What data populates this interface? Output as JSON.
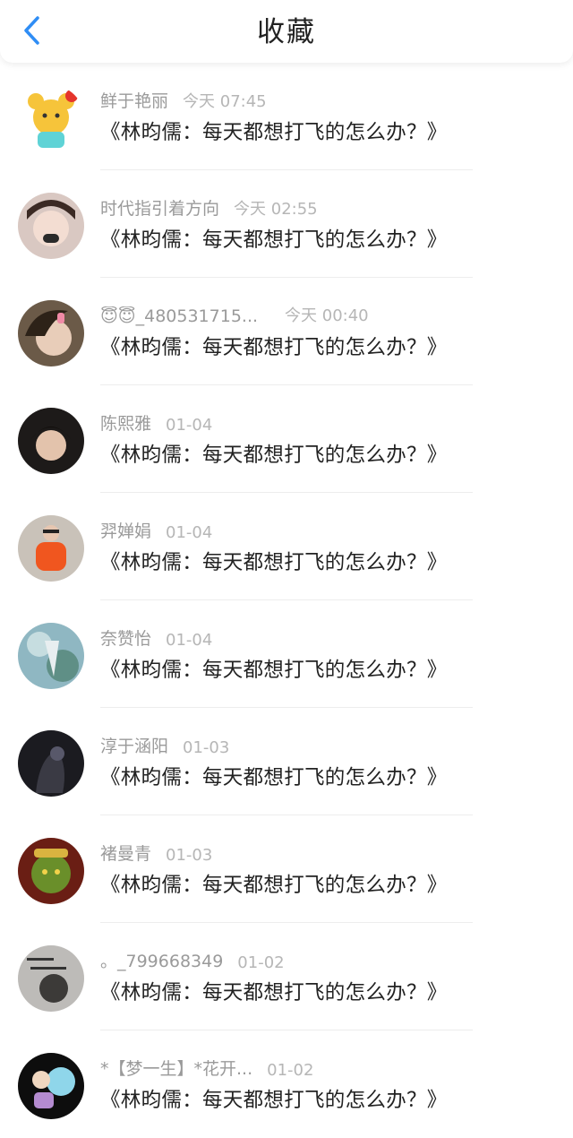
{
  "header": {
    "title": "收藏"
  },
  "items": [
    {
      "name": "鲜于艳丽",
      "time": "今天 07:45",
      "title": "《林昀儒：每天都想打飞的怎么办？》"
    },
    {
      "name": "时代指引着方向",
      "time": "今天 02:55",
      "title": "《林昀儒：每天都想打飞的怎么办？》"
    },
    {
      "name": "😇😇_480531715...",
      "time": "今天 00:40",
      "title": "《林昀儒：每天都想打飞的怎么办？》"
    },
    {
      "name": "陈熙雅",
      "time": "01-04",
      "title": "《林昀儒：每天都想打飞的怎么办？》"
    },
    {
      "name": "羿婵娟",
      "time": "01-04",
      "title": "《林昀儒：每天都想打飞的怎么办？》"
    },
    {
      "name": "奈赞怡",
      "time": "01-04",
      "title": "《林昀儒：每天都想打飞的怎么办？》"
    },
    {
      "name": "淳于涵阳",
      "time": "01-03",
      "title": "《林昀儒：每天都想打飞的怎么办？》"
    },
    {
      "name": "褚曼青",
      "time": "01-03",
      "title": "《林昀儒：每天都想打飞的怎么办？》"
    },
    {
      "name": "。_799668349",
      "time": "01-02",
      "title": "《林昀儒：每天都想打飞的怎么办？》"
    },
    {
      "name": "*【梦一生】*花开...",
      "time": "01-02",
      "title": "《林昀儒：每天都想打飞的怎么办？》"
    }
  ],
  "colors": {
    "accent": "#2f8df5",
    "name": "#9a9a9a",
    "title": "#222222"
  }
}
